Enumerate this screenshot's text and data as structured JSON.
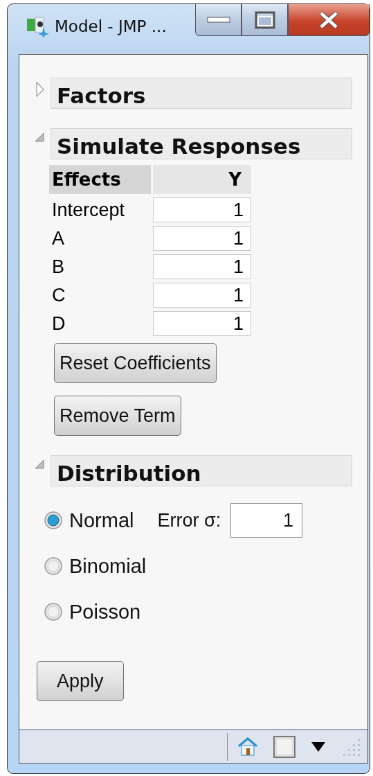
{
  "window": {
    "title": "Model - JMP ..."
  },
  "sections": [
    {
      "title": "Factors",
      "expanded": false
    },
    {
      "kind": "simulate",
      "title": "Simulate Responses",
      "expanded": true,
      "table": {
        "columns": [
          "Effects",
          "Y"
        ],
        "rows": [
          {
            "effect": "Intercept",
            "value": "1"
          },
          {
            "effect": "A",
            "value": "1"
          },
          {
            "effect": "B",
            "value": "1"
          },
          {
            "effect": "C",
            "value": "1"
          },
          {
            "effect": "D",
            "value": "1"
          }
        ]
      },
      "buttons": [
        "Reset Coefficients",
        "Remove Term"
      ]
    },
    {
      "kind": "distribution",
      "title": "Distribution",
      "expanded": true,
      "options": [
        {
          "label": "Normal",
          "selected": true
        },
        {
          "label": "Binomial",
          "selected": false
        },
        {
          "label": "Poisson",
          "selected": false
        }
      ],
      "error": {
        "label": "Error σ:",
        "value": "1"
      }
    }
  ],
  "apply_button": "Apply"
}
